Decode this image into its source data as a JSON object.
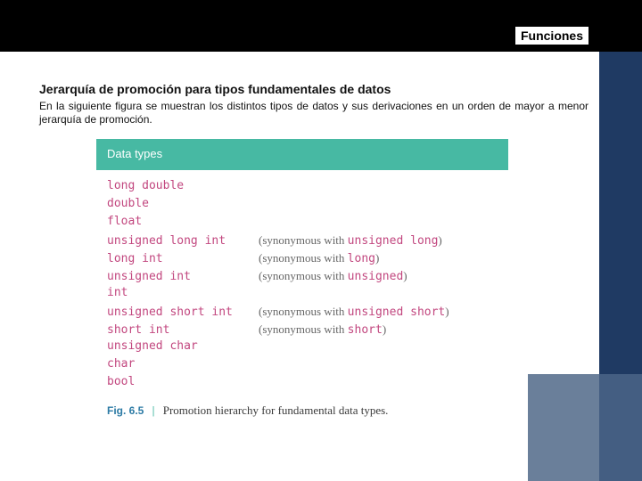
{
  "header": {
    "title": "Funciones"
  },
  "section": {
    "title": "Jerarquía de promoción para tipos fundamentales de datos",
    "body": "En la siguiente figura se muestran los distintos tipos de datos y sus derivaciones en un orden de mayor a menor jerarquía de promoción."
  },
  "figure": {
    "head": "Data types",
    "rows": [
      {
        "type": "long double",
        "prefix": "",
        "alt": "",
        "suffix": ""
      },
      {
        "type": "double",
        "prefix": "",
        "alt": "",
        "suffix": ""
      },
      {
        "type": "float",
        "prefix": "",
        "alt": "",
        "suffix": ""
      },
      {
        "type": "unsigned long int",
        "prefix": "(synonymous with ",
        "alt": "unsigned long",
        "suffix": ")"
      },
      {
        "type": "long int",
        "prefix": "(synonymous with ",
        "alt": "long",
        "suffix": ")"
      },
      {
        "type": "unsigned int",
        "prefix": "(synonymous with ",
        "alt": "unsigned",
        "suffix": ")"
      },
      {
        "type": "int",
        "prefix": "",
        "alt": "",
        "suffix": ""
      },
      {
        "type": "unsigned short int",
        "prefix": "(synonymous with ",
        "alt": "unsigned short",
        "suffix": ")"
      },
      {
        "type": "short int",
        "prefix": "(synonymous with ",
        "alt": "short",
        "suffix": ")"
      },
      {
        "type": "unsigned char",
        "prefix": "",
        "alt": "",
        "suffix": ""
      },
      {
        "type": "char",
        "prefix": "",
        "alt": "",
        "suffix": ""
      },
      {
        "type": "bool",
        "prefix": "",
        "alt": "",
        "suffix": ""
      }
    ],
    "caption": {
      "fignum": "Fig. 6.5",
      "text": "Promotion hierarchy for fundamental data types."
    }
  }
}
